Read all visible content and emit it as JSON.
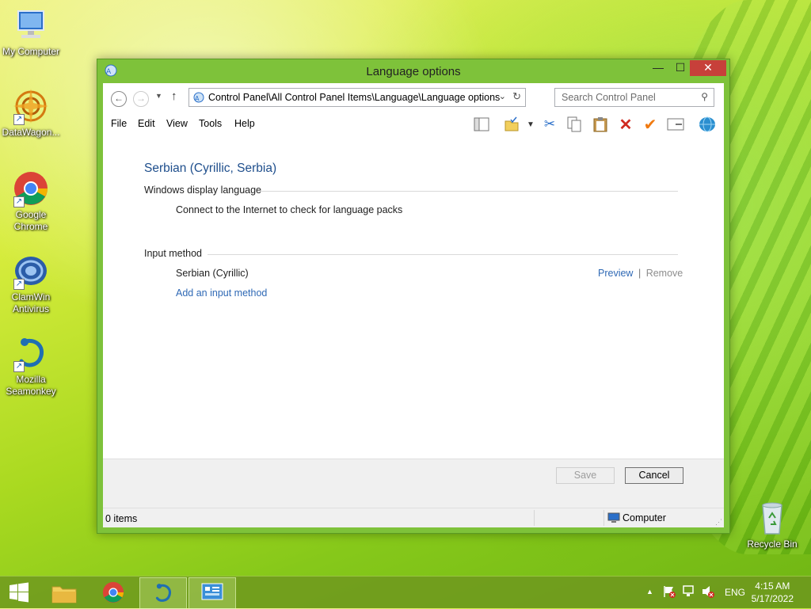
{
  "desktop": {
    "icons": [
      {
        "label": "My Computer"
      },
      {
        "label": "DataWagon..."
      },
      {
        "label": "Google Chrome"
      },
      {
        "label": "ClamWin Antivirus"
      },
      {
        "label": "Mozilla Seamonkey"
      },
      {
        "label": "Recycle Bin"
      }
    ]
  },
  "window": {
    "title": "Language options",
    "controls": {
      "minimize": "—",
      "maximize": "☐",
      "close": "✕"
    }
  },
  "address": {
    "path": "Control Panel\\All Control Panel Items\\Language\\Language options",
    "search_placeholder": "Search Control Panel"
  },
  "menu": [
    "File",
    "Edit",
    "View",
    "Tools",
    "Help"
  ],
  "content": {
    "language_title": "Serbian (Cyrillic, Serbia)",
    "display_language": {
      "heading": "Windows display language",
      "text": "Connect to the Internet to check for language packs"
    },
    "input_method": {
      "heading": "Input method",
      "method_name": "Serbian (Cyrillic)",
      "preview": "Preview",
      "separator": "|",
      "remove": "Remove",
      "add_link": "Add an input method"
    }
  },
  "buttons": {
    "save": "Save",
    "cancel": "Cancel"
  },
  "status": {
    "items": "0 items",
    "location": "Computer"
  },
  "taskbar": {
    "tray": {
      "lang": "ENG"
    },
    "clock": {
      "time": "4:15 AM",
      "date": "5/17/2022"
    }
  },
  "colors": {
    "link": "#2f69b5",
    "title": "#1e4e8c",
    "close": "#c7403a"
  }
}
